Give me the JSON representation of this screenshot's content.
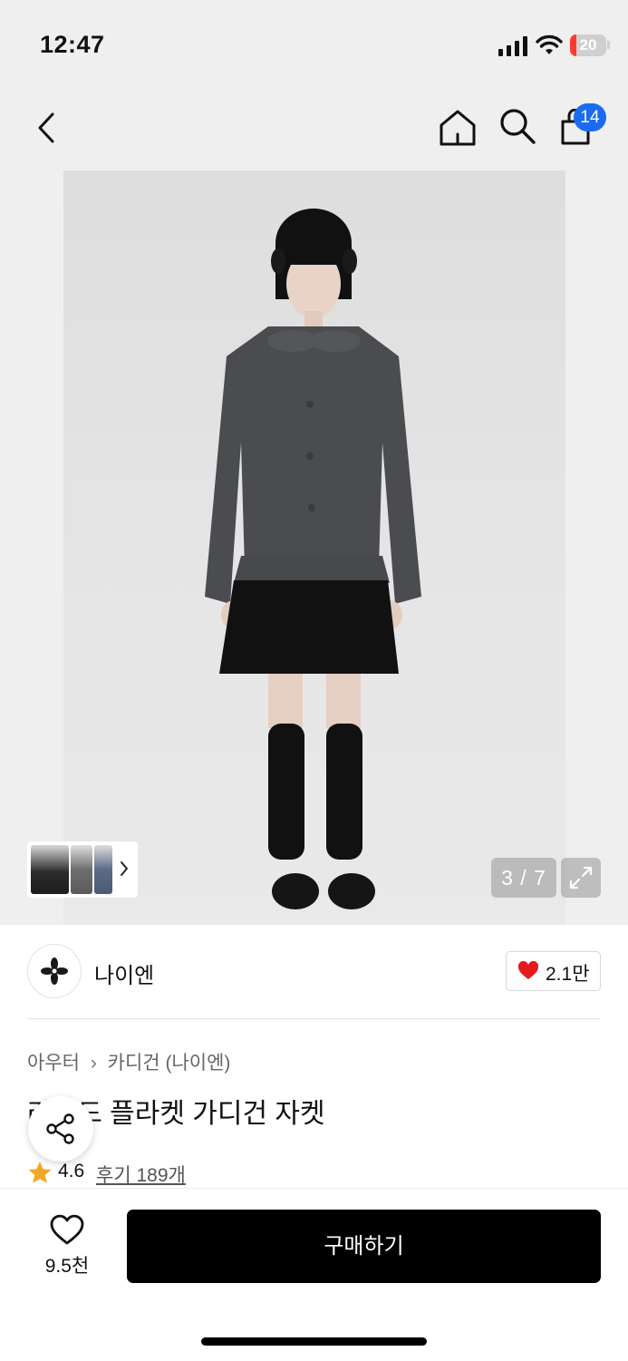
{
  "status": {
    "time": "12:47",
    "battery": "20"
  },
  "nav": {
    "cart_count": "14"
  },
  "gallery": {
    "counter": "3 / 7"
  },
  "brand": {
    "name": "나이엔",
    "likes": "2.1만"
  },
  "breadcrumb": {
    "category": "아우터",
    "subcategory": "카디건 (나이엔)"
  },
  "product": {
    "title": "라운드 플라켓 가디건 자켓",
    "rating": "4.6",
    "reviews": "후기 189개"
  },
  "bottom": {
    "wish_count": "9.5천",
    "buy_label": "구매하기"
  },
  "colors": {
    "accent": "#1b6bf2",
    "heart": "#e8191e",
    "star": "#f5a623",
    "buy_bg": "#000000"
  }
}
